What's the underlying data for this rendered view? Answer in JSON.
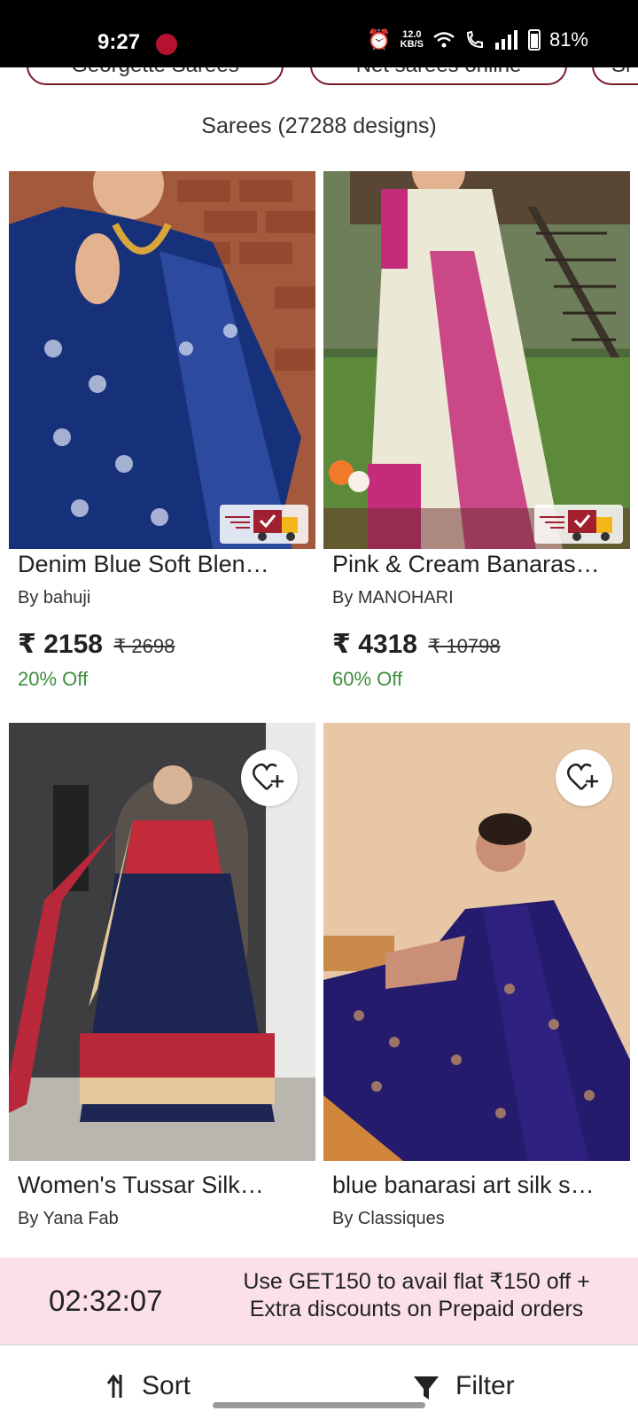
{
  "status_bar": {
    "time": "9:27",
    "speed_value": "12.0",
    "speed_unit": "KB/S",
    "battery": "81%"
  },
  "chips": [
    "Georgette Sarees",
    "Net sarees online",
    "Si"
  ],
  "subtitle": "Sarees (27288 designs)",
  "products": [
    {
      "title": "Denim Blue Soft Blen…",
      "brand": "By bahuji",
      "price": "₹ 2158",
      "mrp": "₹ 2698",
      "off": "20% Off"
    },
    {
      "title": "Pink & Cream Banaras…",
      "brand": "By MANOHARI",
      "price": "₹ 4318",
      "mrp": "₹ 10798",
      "off": "60% Off"
    },
    {
      "title": "Women's Tussar Silk…",
      "brand": "By Yana Fab"
    },
    {
      "title": "blue banarasi art silk s…",
      "brand": "By Classiques"
    }
  ],
  "offer": {
    "timer": "02:32:07",
    "message": "Use GET150 to avail flat ₹150 off + Extra discounts on Prepaid orders"
  },
  "bottom_bar": {
    "sort": "Sort",
    "filter": "Filter"
  },
  "colors": {
    "accent": "#7a1b2b",
    "discount_green": "#3e8e3e",
    "offer_bg": "#fbe1e7"
  }
}
